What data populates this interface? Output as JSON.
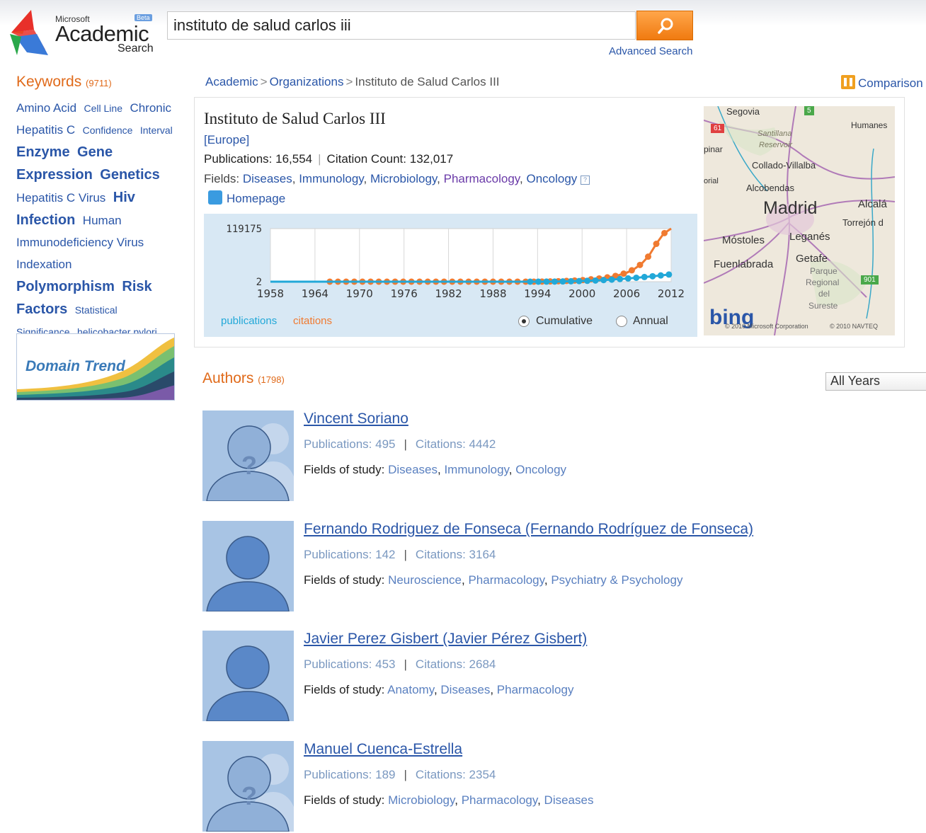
{
  "header": {
    "logo_microsoft": "Microsoft",
    "logo_beta": "Beta",
    "logo_academic": "Academic",
    "logo_search": "Search",
    "search_query": "instituto de salud carlos iii",
    "advanced_search": "Advanced Search"
  },
  "sidebar": {
    "keywords_title": "Keywords",
    "keywords_count": "(9711)",
    "keywords": [
      {
        "label": "Amino Acid",
        "size": "k2"
      },
      {
        "label": "Cell Line",
        "size": "k1"
      },
      {
        "label": "Chronic",
        "size": "k2"
      },
      {
        "label": "Hepatitis C",
        "size": "k2"
      },
      {
        "label": "Confidence",
        "size": "k1"
      },
      {
        "label": "Interval",
        "size": "k1"
      },
      {
        "label": "Enzyme",
        "size": "k3"
      },
      {
        "label": "Gene",
        "size": "k3"
      },
      {
        "label": "Expression",
        "size": "k3"
      },
      {
        "label": "Genetics",
        "size": "k3"
      },
      {
        "label": "Hepatitis C Virus",
        "size": "k2"
      },
      {
        "label": "Hiv",
        "size": "k3"
      },
      {
        "label": "Infection",
        "size": "k3"
      },
      {
        "label": "Human",
        "size": "k2"
      },
      {
        "label": "Immunodeficiency Virus",
        "size": "k2"
      },
      {
        "label": "Indexation",
        "size": "k2"
      },
      {
        "label": "Polymorphism",
        "size": "k3"
      },
      {
        "label": "Risk",
        "size": "k3"
      },
      {
        "label": "Factors",
        "size": "k3"
      },
      {
        "label": "Statistical",
        "size": "k1"
      },
      {
        "label": "Significance",
        "size": "k1"
      },
      {
        "label": "helicobacter pylori",
        "size": "k1"
      }
    ],
    "domain_trend": "Domain Trend"
  },
  "breadcrumb": {
    "items": [
      "Academic",
      "Organizations",
      "Instituto de Salud Carlos III"
    ],
    "separator": ">"
  },
  "comparison": "Comparison",
  "org": {
    "name": "Instituto de Salud Carlos III",
    "region": "[Europe]",
    "publications_label": "Publications:",
    "publications_value": "16,554",
    "citations_label": "Citation Count:",
    "citations_value": "132,017",
    "fields_label": "Fields:",
    "fields": [
      "Diseases",
      "Immunology",
      "Microbiology",
      "Pharmacology",
      "Oncology"
    ],
    "homepage": "Homepage"
  },
  "chart": {
    "legend_publications": "publications",
    "legend_citations": "citations",
    "mode_cumulative": "Cumulative",
    "mode_annual": "Annual",
    "selected_mode": "Cumulative",
    "color_publications": "#22a8d8",
    "color_citations": "#f07a30"
  },
  "chart_data": {
    "type": "line",
    "x_ticks": [
      "1958",
      "1964",
      "1970",
      "1976",
      "1982",
      "1988",
      "1994",
      "2000",
      "2006",
      "2012"
    ],
    "y_ticks": [
      "2",
      "119175"
    ],
    "ylim": [
      2,
      119175
    ],
    "xlim": [
      1958,
      2012
    ],
    "series": [
      {
        "name": "citations",
        "x": [
          1958,
          1962,
          1966,
          1970,
          1974,
          1978,
          1982,
          1986,
          1990,
          1994,
          1996,
          1998,
          2000,
          2002,
          2004,
          2005,
          2006,
          2007,
          2008,
          2009,
          2010,
          2011,
          2012
        ],
        "values": [
          2,
          2,
          2,
          2,
          2,
          2,
          2,
          2,
          2,
          100,
          600,
          1800,
          3500,
          6500,
          11000,
          15000,
          20000,
          28000,
          40000,
          58000,
          85000,
          108000,
          119175
        ]
      },
      {
        "name": "publications",
        "x": [
          1958,
          1964,
          1970,
          1976,
          1982,
          1988,
          1994,
          1996,
          1998,
          2000,
          2002,
          2004,
          2006,
          2008,
          2010,
          2012
        ],
        "values": [
          2,
          2,
          2,
          2,
          2,
          2,
          10,
          200,
          700,
          1500,
          2800,
          4600,
          7000,
          9800,
          13000,
          16554
        ]
      }
    ]
  },
  "map": {
    "labels": [
      "Segovia",
      "Humanes",
      "Santillana",
      "Reservoir",
      "pinar",
      "Collado-Villalba",
      "orial",
      "Alcobendas",
      "Madrid",
      "Alcalá",
      "Torrejón d",
      "Móstoles",
      "Leganés",
      "Getafe",
      "Fuenlabrada",
      "Parque",
      "Regional",
      "del",
      "Sureste"
    ],
    "road_61": "61",
    "road_5": "5",
    "road_901": "901",
    "bing": "bing",
    "copyright1": "© 2010 Microsoft Corporation",
    "copyright2": "© 2010 NAVTEQ"
  },
  "authors": {
    "title": "Authors",
    "count": "(1798)",
    "years_select": "All Years",
    "publications_label": "Publications:",
    "citations_label": "Citations:",
    "fields_label": "Fields of study:",
    "items": [
      {
        "name": "Vincent Soriano",
        "publications": "495",
        "citations": "4442",
        "fields": [
          "Diseases",
          "Immunology",
          "Oncology"
        ],
        "avatar": "unknown"
      },
      {
        "name": "Fernando Rodriguez de Fonseca (Fernando Rodríguez de Fonseca)",
        "publications": "142",
        "citations": "3164",
        "fields": [
          "Neuroscience",
          "Pharmacology",
          "Psychiatry & Psychology"
        ],
        "avatar": "person"
      },
      {
        "name": "Javier Perez Gisbert (Javier Pérez Gisbert)",
        "publications": "453",
        "citations": "2684",
        "fields": [
          "Anatomy",
          "Diseases",
          "Pharmacology"
        ],
        "avatar": "person"
      },
      {
        "name": "Manuel Cuenca-Estrella",
        "publications": "189",
        "citations": "2354",
        "fields": [
          "Microbiology",
          "Pharmacology",
          "Diseases"
        ],
        "avatar": "unknown"
      }
    ]
  }
}
